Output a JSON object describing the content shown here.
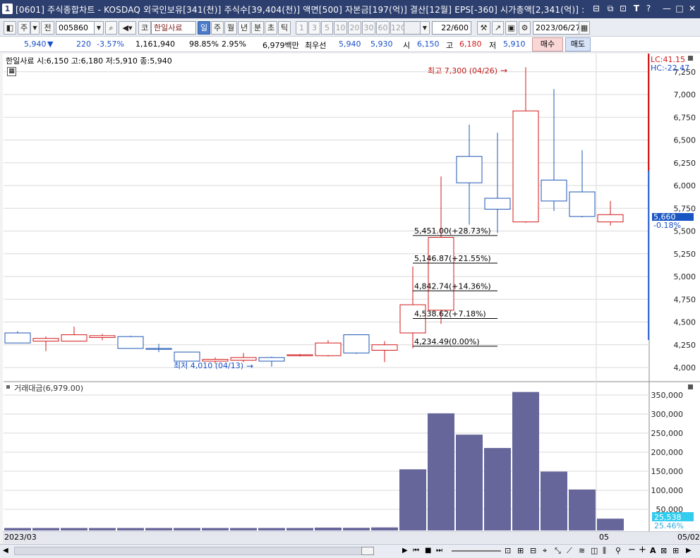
{
  "window": {
    "badge": "1",
    "title": "[0601] 주식종합차트 - KOSDAQ 외국인보유[341(천)] 주식수[39,404(천)] 액면[500] 자본금[197(억)] 결산[12월] EPS[-360] 시가총액[2,341(억)] :",
    "icons": [
      "restore-icon",
      "window-icon",
      "link-icon",
      "font-icon",
      "help-icon",
      "minimize-icon",
      "maximize-icon",
      "close-icon"
    ]
  },
  "toolbar": {
    "btn_ju": "주",
    "btn_jeon": "전",
    "code": "005860",
    "code_badge": "코",
    "stock_name": "한일사료",
    "period_tabs": [
      "일",
      "주",
      "월",
      "년",
      "분",
      "초",
      "틱"
    ],
    "active_period": "일",
    "intervals": [
      "1",
      "3",
      "5",
      "10",
      "20",
      "30",
      "60",
      "120"
    ],
    "count": "22/600",
    "date": "2023/06/27"
  },
  "quote": {
    "price": "5,940",
    "change_arrow": "▼",
    "change": "220",
    "change_pct": "-3.57%",
    "volume": "1,161,940",
    "vol_ratio": "98.85%",
    "turnover": "2.95%",
    "amount": "6,979백만",
    "priority_label": "최우선",
    "best_ask": "5,940",
    "best_bid": "5,930",
    "open_label": "시",
    "open": "6,150",
    "high_label": "고",
    "high": "6,180",
    "low_label": "저",
    "low": "5,910",
    "buy_label": "매수",
    "sell_label": "매도"
  },
  "price_panel": {
    "legend": "한일사료 시:6,150 고:6,180 저:5,910 종:5,940",
    "high_note": "최고 7,300 (04/26)",
    "low_note": "최저 4,010 (04/13)",
    "lc_label": "LC:41.15",
    "hc_label": "HC:-22.47",
    "current_price_tag": "5,660",
    "current_change_tag": "-0.18%",
    "fib_levels": [
      {
        "price": 5451,
        "label": "5,451.00(+28.73%)"
      },
      {
        "price": 5146.87,
        "label": "5,146.87(+21.55%)"
      },
      {
        "price": 4842.74,
        "label": "4,842.74(+14.36%)"
      },
      {
        "price": 4538.62,
        "label": "4,538.62(+7.18%)"
      },
      {
        "price": 4234.49,
        "label": "4,234.49(0.00%)"
      }
    ]
  },
  "volume_panel": {
    "legend": "거래대금(6,979.00)",
    "current_tag": "25,538",
    "current_pct_tag": "25.46%"
  },
  "date_axis": {
    "start": "2023/03",
    "mid": "05",
    "end": "05/02"
  },
  "colors": {
    "up": "#d21a1a",
    "down": "#1f56b5",
    "volume": "#66669b",
    "fib": "#000000"
  },
  "chart_data": [
    {
      "type": "candlestick",
      "title": "한일사료",
      "y_ticks": [
        4000,
        4250,
        4500,
        4750,
        5000,
        5250,
        5500,
        5750,
        6000,
        6250,
        6500,
        6750,
        7000,
        7250
      ],
      "ylim": [
        3900,
        7550
      ],
      "x_start_label": "2023/03",
      "candles": [
        {
          "o": 4380,
          "h": 4400,
          "l": 4270,
          "c": 4270
        },
        {
          "o": 4290,
          "h": 4340,
          "l": 4180,
          "c": 4320
        },
        {
          "o": 4290,
          "h": 4450,
          "l": 4290,
          "c": 4360
        },
        {
          "o": 4330,
          "h": 4370,
          "l": 4300,
          "c": 4350
        },
        {
          "o": 4340,
          "h": 4350,
          "l": 4210,
          "c": 4210
        },
        {
          "o": 4210,
          "h": 4260,
          "l": 4170,
          "c": 4200
        },
        {
          "o": 4170,
          "h": 4170,
          "l": 4080,
          "c": 4070
        },
        {
          "o": 4070,
          "h": 4110,
          "l": 4040,
          "c": 4090
        },
        {
          "o": 4080,
          "h": 4160,
          "l": 4060,
          "c": 4110
        },
        {
          "o": 4110,
          "h": 4120,
          "l": 4010,
          "c": 4070
        },
        {
          "o": 4130,
          "h": 4150,
          "l": 4120,
          "c": 4140
        },
        {
          "o": 4130,
          "h": 4300,
          "l": 4120,
          "c": 4270
        },
        {
          "o": 4360,
          "h": 4360,
          "l": 4150,
          "c": 4160
        },
        {
          "o": 4190,
          "h": 4290,
          "l": 4060,
          "c": 4250
        },
        {
          "o": 4380,
          "h": 5110,
          "l": 4210,
          "c": 4690
        },
        {
          "o": 4630,
          "h": 6100,
          "l": 4480,
          "c": 5430
        },
        {
          "o": 6320,
          "h": 6670,
          "l": 5570,
          "c": 6030
        },
        {
          "o": 5860,
          "h": 6580,
          "l": 5480,
          "c": 5740
        },
        {
          "o": 5600,
          "h": 7300,
          "l": 5590,
          "c": 6820
        },
        {
          "o": 6060,
          "h": 7060,
          "l": 5720,
          "c": 5830
        },
        {
          "o": 5930,
          "h": 6390,
          "l": 5650,
          "c": 5660
        },
        {
          "o": 5600,
          "h": 5830,
          "l": 5560,
          "c": 5680
        }
      ]
    },
    {
      "type": "bar",
      "title": "거래대금",
      "y_ticks": [
        50000,
        100000,
        150000,
        200000,
        250000,
        300000,
        350000
      ],
      "ylim": [
        0,
        370000
      ],
      "values": [
        1000,
        1000,
        1000,
        1000,
        1000,
        1000,
        1000,
        1000,
        1000,
        1000,
        1000,
        2000,
        1500,
        2500,
        155000,
        302000,
        246000,
        211000,
        358000,
        149000,
        102000,
        25538
      ]
    }
  ]
}
